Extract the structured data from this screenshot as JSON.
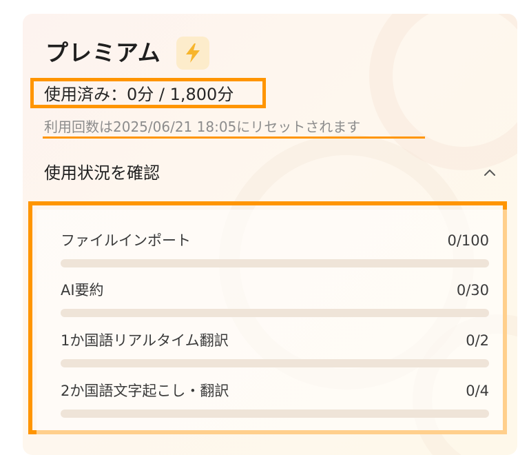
{
  "plan": {
    "title": "プレミアム",
    "badge_icon": "lightning-bolt-icon",
    "accent_color": "#ff9500",
    "badge_icon_color": "#f7b52c"
  },
  "usage": {
    "summary": "使用済み：0分 / 1,800分",
    "reset_notice": "利用回数は2025/06/21 18:05にリセットされます"
  },
  "section": {
    "label": "使用状況を確認",
    "toggle_icon": "chevron-up-icon"
  },
  "items": [
    {
      "label": "ファイルインポート",
      "count": "0/100",
      "progress": 0
    },
    {
      "label": "AI要約",
      "count": "0/30",
      "progress": 0
    },
    {
      "label": "1か国語リアルタイム翻訳",
      "count": "0/2",
      "progress": 0
    },
    {
      "label": "2か国語文字起こし・翻訳",
      "count": "0/4",
      "progress": 0
    }
  ]
}
